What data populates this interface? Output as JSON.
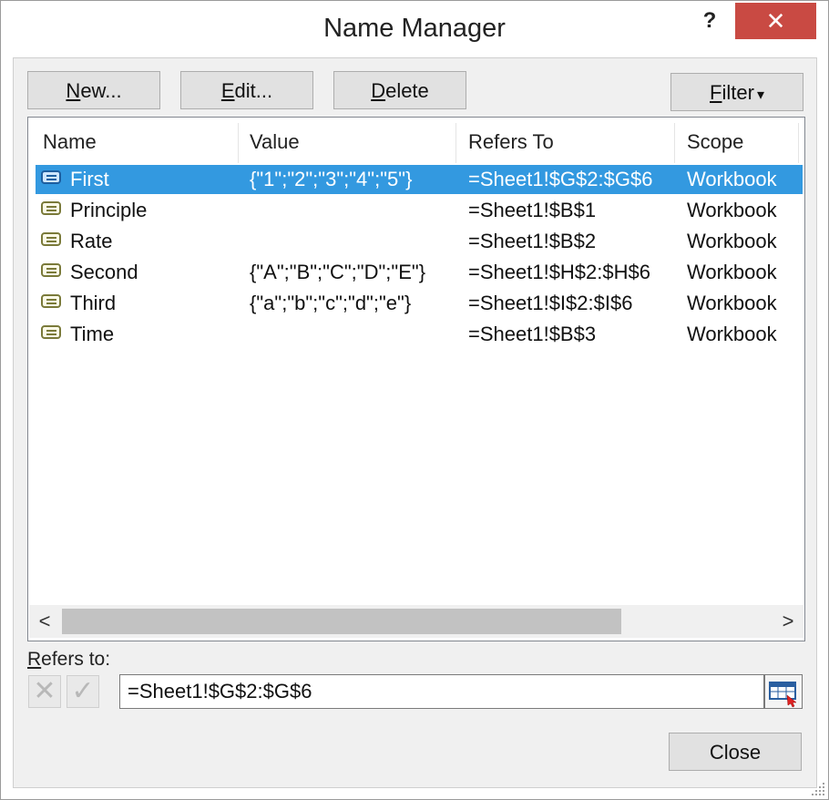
{
  "window": {
    "title": "Name Manager",
    "help": "?",
    "close": "✕"
  },
  "toolbar": {
    "new_pre": "",
    "new_u": "N",
    "new_post": "ew...",
    "edit_pre": "",
    "edit_u": "E",
    "edit_post": "dit...",
    "delete_pre": "",
    "delete_u": "D",
    "delete_post": "elete",
    "filter_pre": "",
    "filter_u": "F",
    "filter_post": "ilter",
    "filter_arrow": "▾"
  },
  "table": {
    "columns": [
      "Name",
      "Value",
      "Refers To",
      "Scope"
    ],
    "rows": [
      {
        "name": "First",
        "value": "{\"1\";\"2\";\"3\";\"4\";\"5\"}",
        "refers": "=Sheet1!$G$2:$G$6",
        "scope": "Workbook",
        "selected": true
      },
      {
        "name": "Principle",
        "value": "",
        "refers": "=Sheet1!$B$1",
        "scope": "Workbook",
        "selected": false
      },
      {
        "name": "Rate",
        "value": "",
        "refers": "=Sheet1!$B$2",
        "scope": "Workbook",
        "selected": false
      },
      {
        "name": "Second",
        "value": "{\"A\";\"B\";\"C\";\"D\";\"E\"}",
        "refers": "=Sheet1!$H$2:$H$6",
        "scope": "Workbook",
        "selected": false
      },
      {
        "name": "Third",
        "value": "{\"a\";\"b\";\"c\";\"d\";\"e\"}",
        "refers": "=Sheet1!$I$2:$I$6",
        "scope": "Workbook",
        "selected": false
      },
      {
        "name": "Time",
        "value": "",
        "refers": "=Sheet1!$B$3",
        "scope": "Workbook",
        "selected": false
      }
    ]
  },
  "scroll": {
    "left": "<",
    "right": ">"
  },
  "refers_to": {
    "label_u": "R",
    "label_post": "efers to:",
    "cancel_glyph": "✕",
    "confirm_glyph": "✓",
    "value": "=Sheet1!$G$2:$G$6"
  },
  "footer": {
    "close_label": "Close"
  },
  "colors": {
    "selection": "#3399e0",
    "close_button": "#c94a43"
  }
}
